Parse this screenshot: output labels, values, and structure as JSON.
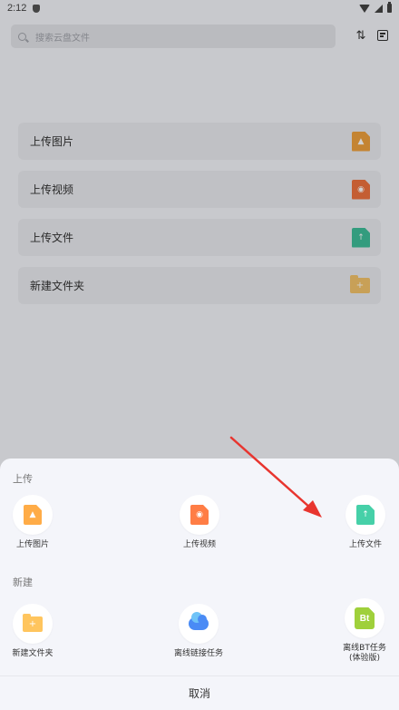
{
  "status_bar": {
    "time": "2:12"
  },
  "search": {
    "placeholder": "搜索云盘文件"
  },
  "background_list": [
    {
      "label": "上传图片",
      "icon": "image-file-icon",
      "color": "#f0a13e"
    },
    {
      "label": "上传视频",
      "icon": "video-file-icon",
      "color": "#f0733f"
    },
    {
      "label": "上传文件",
      "icon": "upload-file-icon",
      "color": "#3fbf9a"
    },
    {
      "label": "新建文件夹",
      "icon": "folder-icon",
      "color": "#f5c46b"
    }
  ],
  "sheet": {
    "upload_section_title": "上传",
    "upload_actions": [
      {
        "label": "上传图片",
        "icon": "image-file-icon",
        "color": "#ffac47"
      },
      {
        "label": "上传视频",
        "icon": "video-file-icon",
        "color": "#ff7d45"
      },
      {
        "label": "上传文件",
        "icon": "upload-file-icon",
        "color": "#46d0a8"
      }
    ],
    "new_section_title": "新建",
    "new_actions": [
      {
        "label": "新建文件夹",
        "icon": "folder-icon",
        "color": "#ffc55e"
      },
      {
        "label": "离线链接任务",
        "icon": "cloud-link-icon",
        "color": "#4a8bf5"
      },
      {
        "label": "离线BT任务\n(体验版)",
        "icon": "bt-file-icon",
        "color": "#9fd03b"
      }
    ],
    "cancel_label": "取消"
  },
  "annotation": {
    "arrow_color": "#e8352f"
  }
}
